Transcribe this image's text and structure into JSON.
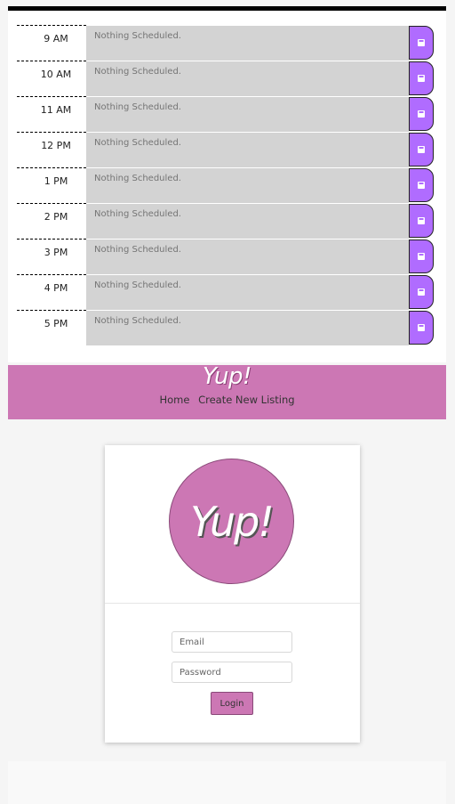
{
  "scheduler": {
    "placeholder": "Nothing Scheduled.",
    "rows": [
      {
        "hour": "9 AM"
      },
      {
        "hour": "10 AM"
      },
      {
        "hour": "11 AM"
      },
      {
        "hour": "12 PM"
      },
      {
        "hour": "1 PM"
      },
      {
        "hour": "2 PM"
      },
      {
        "hour": "3 PM"
      },
      {
        "hour": "4 PM"
      },
      {
        "hour": "5 PM"
      }
    ],
    "save_icon": "floppy-disk-icon",
    "colors": {
      "row_bg": "#d3d3d3",
      "save_button": "#b06cff"
    }
  },
  "navbar": {
    "brand": "Yup!",
    "links": [
      "Home",
      "Create New Listing"
    ],
    "color": "#cc77b4"
  },
  "login": {
    "logo_text": "Yup!",
    "email_placeholder": "Email",
    "password_placeholder": "Password",
    "button_label": "Login"
  }
}
